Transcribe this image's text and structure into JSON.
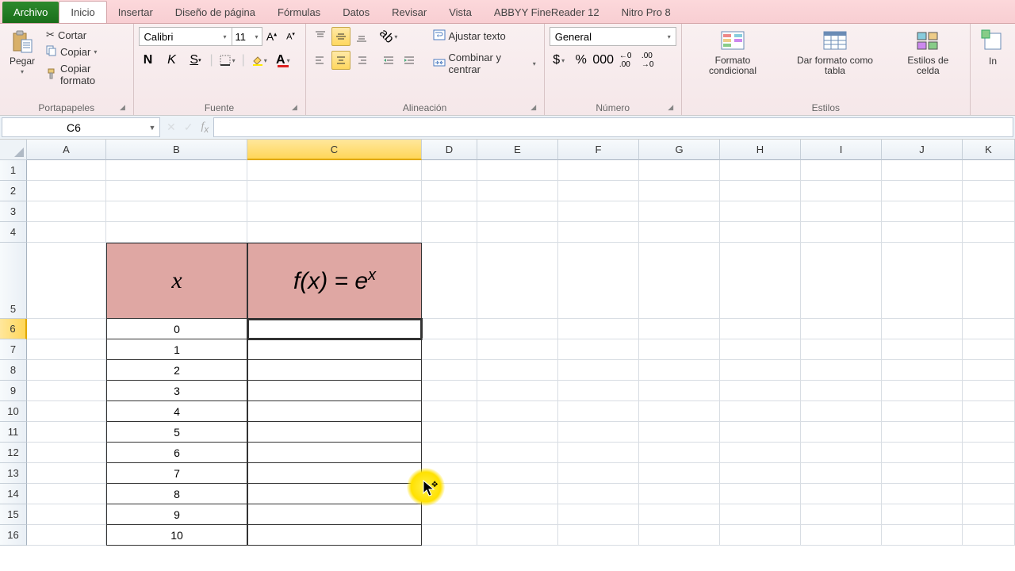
{
  "tabs": {
    "file": "Archivo",
    "home": "Inicio",
    "insert": "Insertar",
    "pagelayout": "Diseño de página",
    "formulas": "Fórmulas",
    "data": "Datos",
    "review": "Revisar",
    "view": "Vista",
    "abbyy": "ABBYY FineReader 12",
    "nitro": "Nitro Pro 8"
  },
  "ribbon": {
    "clipboard": {
      "paste": "Pegar",
      "cut": "Cortar",
      "copy": "Copiar",
      "formatpainter": "Copiar formato",
      "label": "Portapapeles"
    },
    "font": {
      "name": "Calibri",
      "size": "11",
      "label": "Fuente"
    },
    "alignment": {
      "wrap": "Ajustar texto",
      "merge": "Combinar y centrar",
      "label": "Alineación"
    },
    "number": {
      "format": "General",
      "label": "Número"
    },
    "styles": {
      "condfmt": "Formato condicional",
      "tablefmt": "Dar formato como tabla",
      "cellstyles": "Estilos de celda",
      "label": "Estilos"
    },
    "cells": {
      "insert": "In"
    }
  },
  "namebox": "C6",
  "columns": [
    "A",
    "B",
    "C",
    "D",
    "E",
    "F",
    "G",
    "H",
    "I",
    "J",
    "K"
  ],
  "rowcount": 16,
  "table": {
    "header_x": "x",
    "header_fx_prefix": "f(x) = e",
    "header_fx_sup": "x",
    "x_values": [
      "0",
      "1",
      "2",
      "3",
      "4",
      "5",
      "6",
      "7",
      "8",
      "9",
      "10"
    ]
  },
  "selected": {
    "col": "C",
    "row": 6
  }
}
